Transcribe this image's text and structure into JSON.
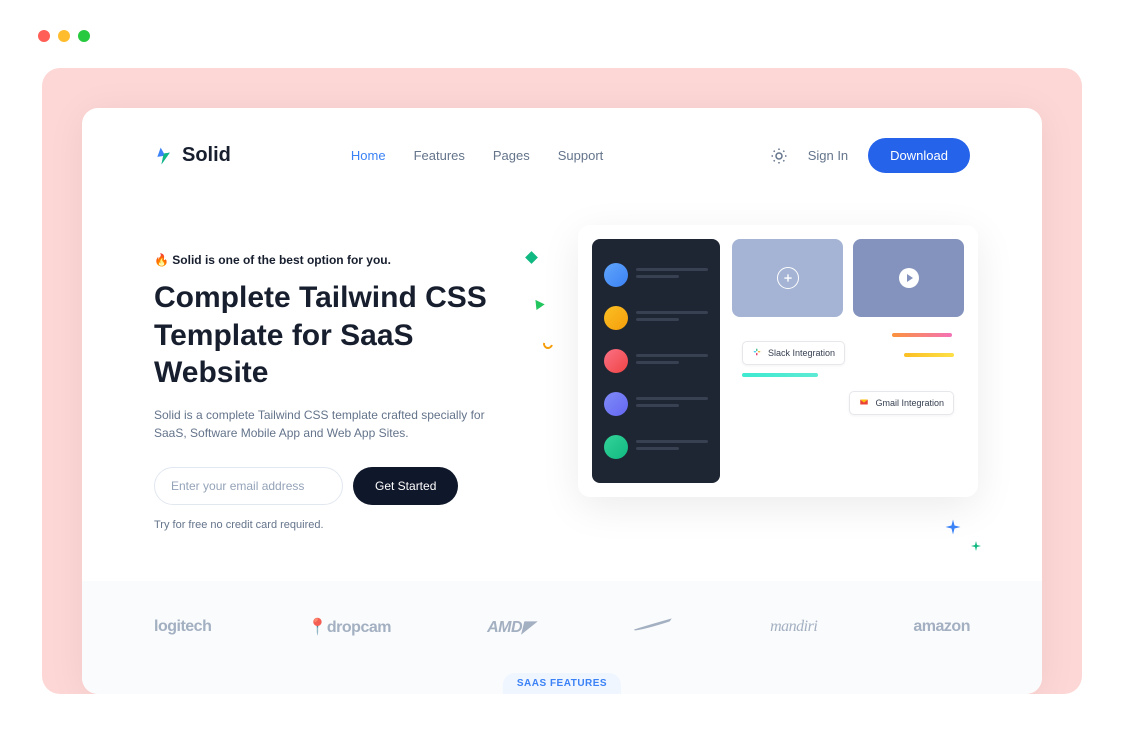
{
  "brand": {
    "name": "Solid"
  },
  "nav": {
    "links": [
      {
        "label": "Home",
        "active": true
      },
      {
        "label": "Features",
        "active": false
      },
      {
        "label": "Pages",
        "active": false
      },
      {
        "label": "Support",
        "active": false
      }
    ],
    "sign_in": "Sign In",
    "download": "Download"
  },
  "hero": {
    "tag_emoji": "🔥",
    "tag_text": "Solid is one of the best option for you.",
    "title_line1": "Complete Tailwind CSS",
    "title_line2_a": "Template for",
    "title_line2_b": "SaaS Website",
    "description": "Solid is a complete Tailwind CSS template crafted specially for SaaS, Software Mobile App and Web App Sites.",
    "email_placeholder": "Enter your email address",
    "cta": "Get Started",
    "note": "Try for free no credit card required."
  },
  "mockup": {
    "integration_slack": "Slack Integration",
    "integration_gmail": "Gmail Integration"
  },
  "clients": [
    {
      "name": "logitech"
    },
    {
      "name": "dropcam"
    },
    {
      "name": "AMD"
    },
    {
      "name": "nike_swoosh"
    },
    {
      "name": "mandiri"
    },
    {
      "name": "amazon"
    }
  ],
  "features_section_tag": "SAAS FEATURES"
}
